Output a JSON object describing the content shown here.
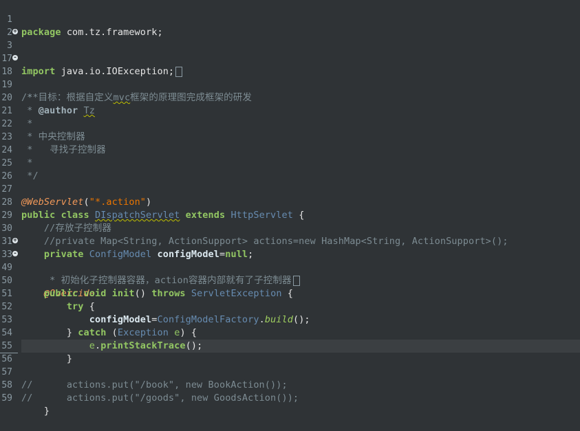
{
  "lines": [
    {
      "no": "1",
      "code": "package com.tz.framework;"
    },
    {
      "no": "2",
      "code": ""
    },
    {
      "no": "3",
      "fold": "+",
      "code": "import java.io.IOException;"
    },
    {
      "no": "17",
      "code": ""
    },
    {
      "no": "18",
      "fold": "-",
      "code": "/**"
    },
    {
      "no": "19",
      "code": " * 目标：根据自定义mvc框架的原理图完成框架的研发"
    },
    {
      "no": "20",
      "code": " * @author Tz"
    },
    {
      "no": "21",
      "code": " *"
    },
    {
      "no": "22",
      "code": " * 中央控制器"
    },
    {
      "no": "23",
      "code": " *   寻找子控制器"
    },
    {
      "no": "24",
      "code": " *"
    },
    {
      "no": "25",
      "code": " */"
    },
    {
      "no": "26",
      "code": ""
    },
    {
      "no": "27",
      "code": "@WebServlet(\"*.action\")"
    },
    {
      "no": "28",
      "code": "public class DIspatchServlet extends HttpServlet {"
    },
    {
      "no": "29",
      "code": "    //存放子控制器"
    },
    {
      "no": "30",
      "code": "    //private Map<String, ActionSupport> actions=new HashMap<String, ActionSupport>();"
    },
    {
      "no": "31",
      "code": "    private ConfigModel configModel=null;"
    },
    {
      "no": "33",
      "fold": "+",
      "code": "     * 初始化子控制器容器，action容器内部就有了子控制器"
    },
    {
      "no": "49",
      "fold": "-",
      "code": "    @Override"
    },
    {
      "no": "50",
      "code": "    public void init() throws ServletException {"
    },
    {
      "no": "51",
      "code": "        try {"
    },
    {
      "no": "52",
      "code": "            configModel=ConfigModelFactory.build();"
    },
    {
      "no": "53",
      "code": "        } catch (Exception e) {"
    },
    {
      "no": "54",
      "code": "            e.printStackTrace();"
    },
    {
      "no": "55",
      "code": "        }"
    },
    {
      "no": "56",
      "code": ""
    },
    {
      "no": "57",
      "code": "//      actions.put(\"/book\", new BookAction());"
    },
    {
      "no": "58",
      "code": "//      actions.put(\"/goods\", new GoodsAction());"
    },
    {
      "no": "59",
      "code": "    }"
    }
  ]
}
